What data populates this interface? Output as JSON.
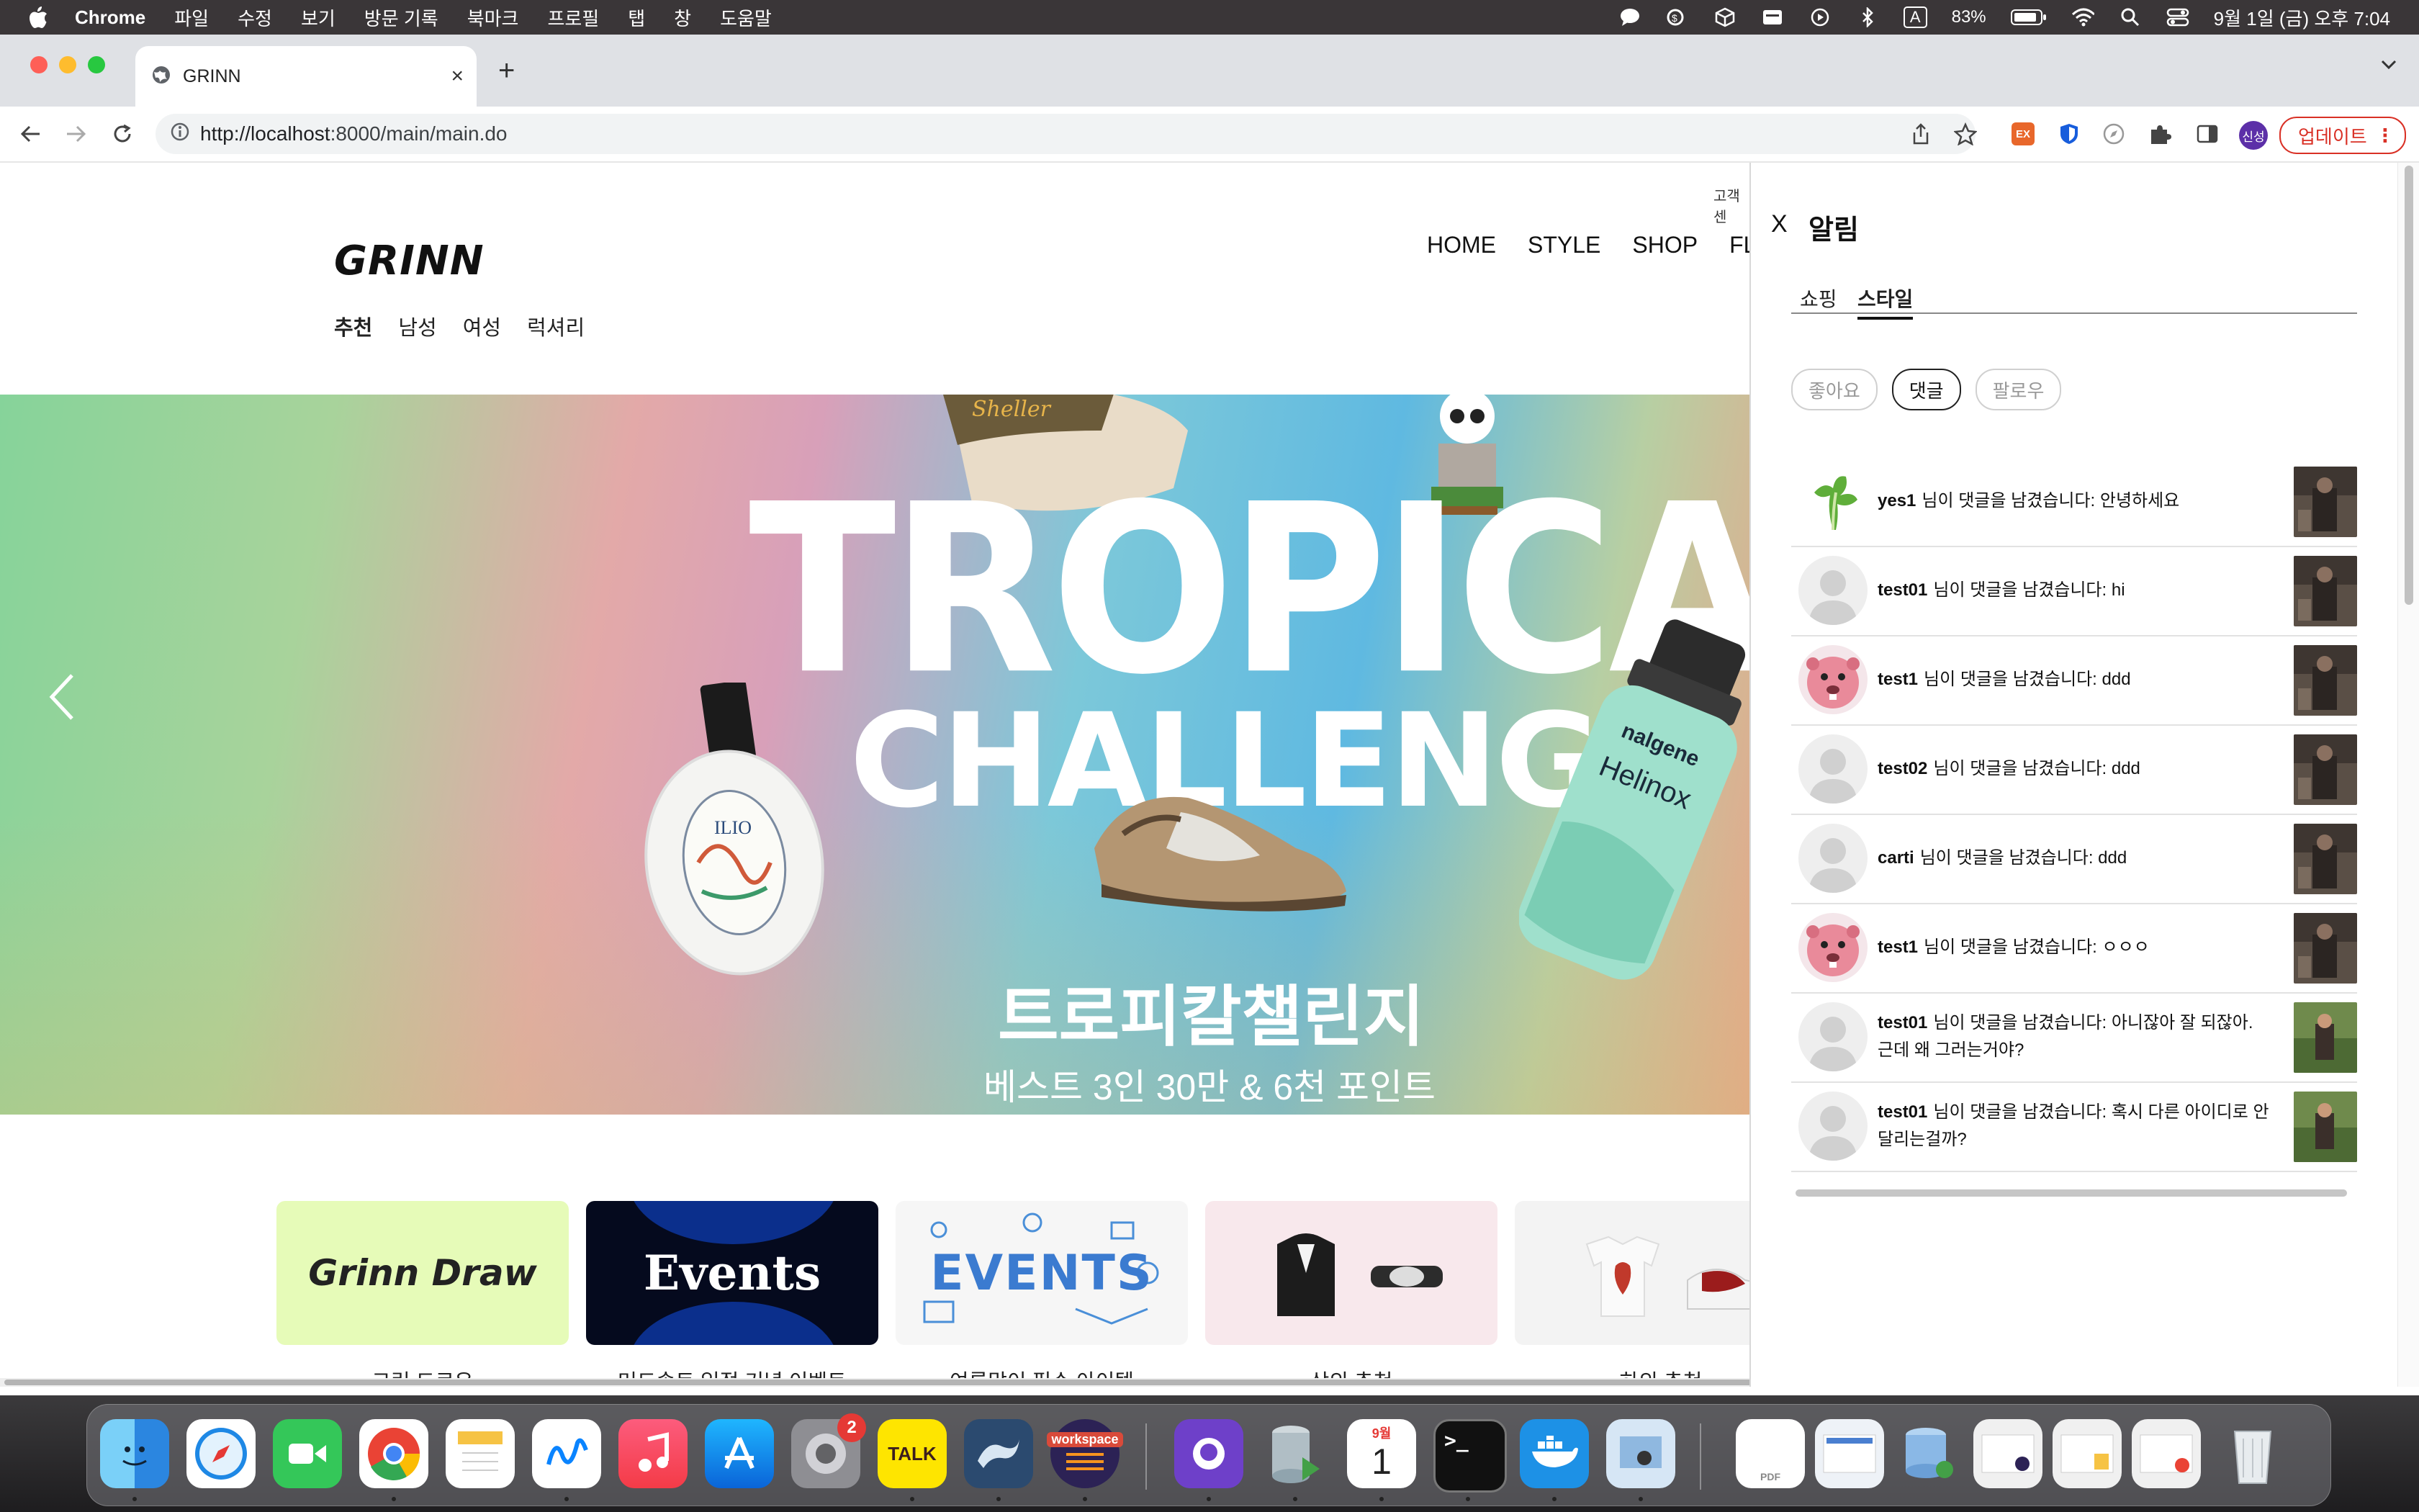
{
  "menubar": {
    "app_name": "Chrome",
    "items": [
      "파일",
      "수정",
      "보기",
      "방문 기록",
      "북마크",
      "프로필",
      "탭",
      "창",
      "도움말"
    ],
    "battery": "83%",
    "datetime": "9월 1일 (금) 오후 7:04",
    "input_indicator": "A"
  },
  "browser": {
    "tab_title": "GRINN",
    "url_host": "http://localhost",
    "url_path": ":8000/main/main.do",
    "profile_initials": "신성",
    "update_label": "업데이트",
    "ext_label": "EX"
  },
  "site": {
    "logo": "GRINN",
    "top_link": "고객센",
    "main_nav": [
      "HOME",
      "STYLE",
      "SHOP",
      "FLEA"
    ],
    "sub_nav": [
      "추천",
      "남성",
      "여성",
      "럭셔리"
    ],
    "banner": {
      "title_line1": "TROPICAL",
      "title_line2": "CHALLENGE",
      "title_kr": "트로피칼챌린지",
      "subtitle": "베스트 3인 30만 & 6천 포인트",
      "bottle_brand1": "nalgene",
      "bottle_brand2": "Helinox",
      "perfume_label": "ILIO"
    },
    "tiles": [
      {
        "art": "Grinn Draw",
        "label": "그린 드로우"
      },
      {
        "art": "Events",
        "label": "머드솔트 입점 기념 이벤트"
      },
      {
        "art": "EVENTS",
        "label": "여름맞이 필수 아이템"
      },
      {
        "art": "",
        "label": "상의 추천"
      },
      {
        "art": "",
        "label": "하의 추천"
      }
    ]
  },
  "notifications": {
    "close_label": "X",
    "title": "알림",
    "tabs": [
      "쇼핑",
      "스타일"
    ],
    "active_tab": "스타일",
    "filters": [
      "좋아요",
      "댓글",
      "팔로우"
    ],
    "active_filter": "댓글",
    "items": [
      {
        "user": "yes1",
        "text": "님이 댓글을 남겼습니다: 안녕하세요",
        "avatar": "lettuce"
      },
      {
        "user": "test01",
        "text": "님이 댓글을 남겼습니다: hi",
        "avatar": "default"
      },
      {
        "user": "test1",
        "text": "님이 댓글을 남겼습니다: ddd",
        "avatar": "pink-beaver"
      },
      {
        "user": "test02",
        "text": "님이 댓글을 남겼습니다: ddd",
        "avatar": "default"
      },
      {
        "user": "carti",
        "text": "님이 댓글을 남겼습니다: ddd",
        "avatar": "default"
      },
      {
        "user": "test1",
        "text": "님이 댓글을 남겼습니다: ㅇㅇㅇ",
        "avatar": "pink-beaver"
      },
      {
        "user": "test01",
        "text": "님이 댓글을 남겼습니다: 아니잖아 잘 되잖아. 근데 왜 그러는거야?",
        "avatar": "default"
      },
      {
        "user": "test01",
        "text": "님이 댓글을 남겼습니다: 혹시 다른 아이디로 안달리는걸까?",
        "avatar": "default"
      }
    ]
  },
  "dock": {
    "badge_settings": "2",
    "kakao_label": "TALK",
    "workspace_label": "workspace",
    "calendar_month": "9월",
    "calendar_day": "1",
    "terminal_prompt": ">_",
    "pdf_label": "PDF",
    "apps": [
      "finder-icon",
      "safari-icon",
      "facetime-icon",
      "chrome-icon",
      "notes-icon",
      "freeform-icon",
      "music-icon",
      "appstore-icon",
      "settings-icon",
      "kakaotalk-icon",
      "mysql-workbench-icon",
      "eclipse-icon",
      "github-desktop-icon",
      "db-runner-icon",
      "calendar-icon",
      "terminal-icon",
      "docker-icon",
      "preview-icon"
    ]
  }
}
